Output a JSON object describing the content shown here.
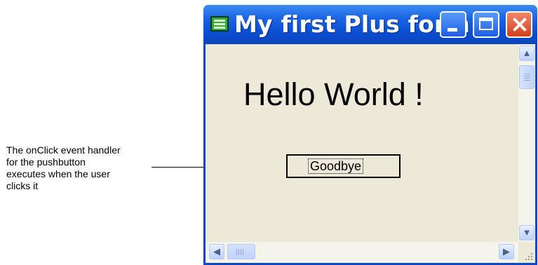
{
  "annotation": {
    "text": "The onClick event handler\nfor the pushbutton\nexecutes when the user\nclicks it"
  },
  "window": {
    "title": "My first Plus form",
    "icon": "form-app-icon",
    "controls": [
      "minimize-icon",
      "maximize-icon",
      "close-icon"
    ]
  },
  "form": {
    "hello_text": "Hello World !",
    "button_label": "Goodbye"
  },
  "scrollbars": {
    "vertical": {
      "up_icon": "▲",
      "down_icon": "▼"
    },
    "horizontal": {
      "left_icon": "◀",
      "right_icon": "▶"
    }
  },
  "colors": {
    "titlebar": "#0a4ed2",
    "client_background": "#ece9d8",
    "close_button": "#d2401c"
  }
}
